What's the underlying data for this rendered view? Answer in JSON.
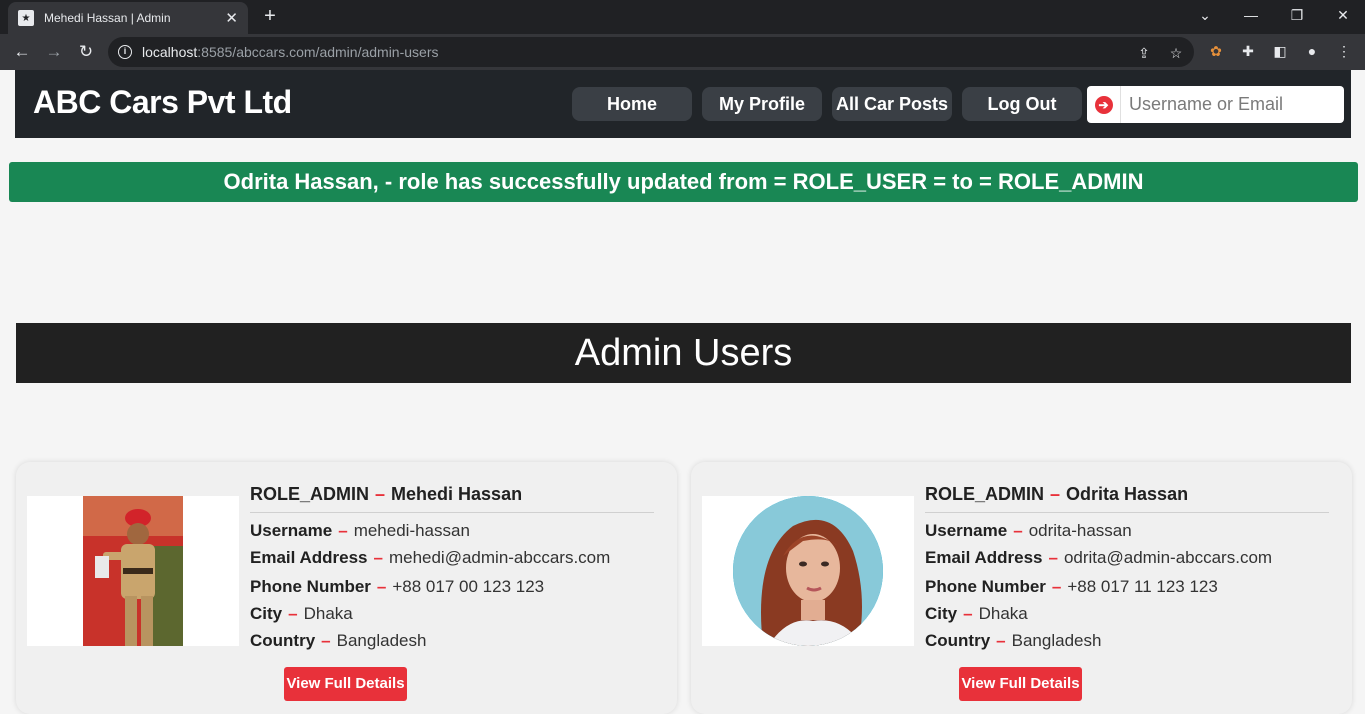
{
  "browser": {
    "tab_title": "Mehedi Hassan | Admin",
    "url_host": "localhost",
    "url_rest": ":8585/abccars.com/admin/admin-users"
  },
  "header": {
    "brand": "ABC Cars Pvt Ltd",
    "nav": [
      "Home",
      "My Profile",
      "All Car Posts",
      "Log Out"
    ],
    "search_placeholder": "Username or Email"
  },
  "alert": {
    "message": "Odrita Hassan, - role has successfully updated from = ROLE_USER = to = ROLE_ADMIN",
    "color": "#198754"
  },
  "section_title": "Admin Users",
  "labels": {
    "username": "Username",
    "email": "Email Address",
    "phone": "Phone Number",
    "city": "City",
    "country": "Country",
    "view_button": "View Full Details"
  },
  "users": [
    {
      "role": "ROLE_ADMIN",
      "name": "Mehedi Hassan",
      "username": "mehedi-hassan",
      "email": "mehedi@admin-abccars.com",
      "phone": "+88 017 00 123 123",
      "city": "Dhaka",
      "country": "Bangladesh"
    },
    {
      "role": "ROLE_ADMIN",
      "name": "Odrita Hassan",
      "username": "odrita-hassan",
      "email": "odrita@admin-abccars.com",
      "phone": "+88 017 11 123 123",
      "city": "Dhaka",
      "country": "Bangladesh"
    }
  ],
  "colors": {
    "accent": "#e8313a",
    "header_bg": "#212529",
    "section_bg": "#212121"
  }
}
